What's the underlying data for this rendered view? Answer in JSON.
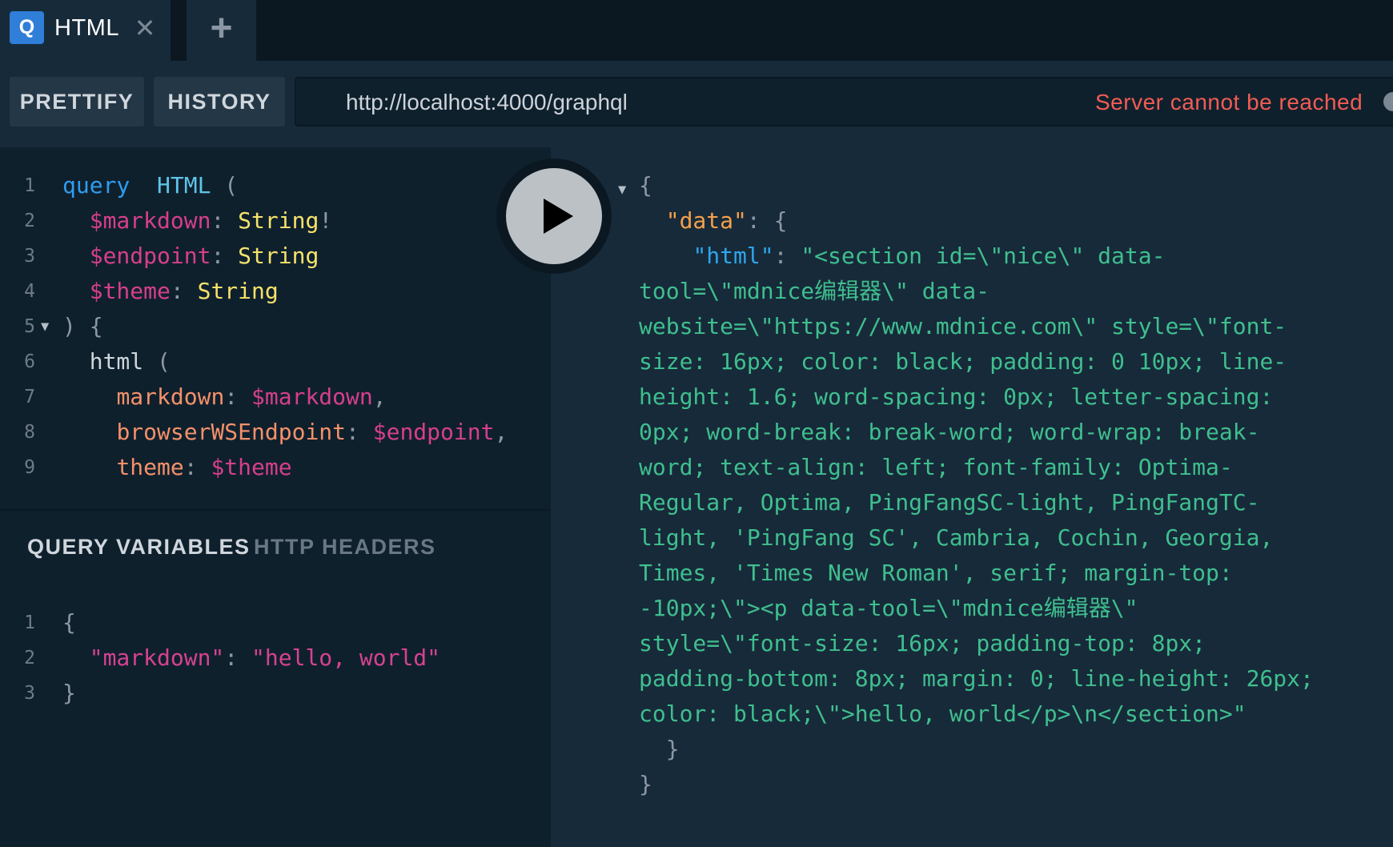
{
  "tab": {
    "logo_letter": "Q",
    "title": "HTML",
    "close_glyph": "✕",
    "add_glyph": "+"
  },
  "toolbar": {
    "prettify_label": "PRETTIFY",
    "history_label": "HISTORY",
    "endpoint_url": "http://localhost:4000/graphql",
    "server_status": "Server cannot be reached"
  },
  "query_editor": {
    "line_numbers": [
      "1",
      "2",
      "3",
      "4",
      "5",
      "6",
      "7",
      "8",
      "9"
    ],
    "lines": [
      [
        [
          "kw",
          "query"
        ],
        [
          "",
          "  "
        ],
        [
          "defname",
          "HTML"
        ],
        [
          "punct",
          " ("
        ]
      ],
      [
        [
          "",
          "  "
        ],
        [
          "var",
          "$markdown"
        ],
        [
          "punct",
          ": "
        ],
        [
          "type",
          "String"
        ],
        [
          "punct",
          "!"
        ]
      ],
      [
        [
          "",
          "  "
        ],
        [
          "var",
          "$endpoint"
        ],
        [
          "punct",
          ": "
        ],
        [
          "type",
          "String"
        ]
      ],
      [
        [
          "",
          "  "
        ],
        [
          "var",
          "$theme"
        ],
        [
          "punct",
          ": "
        ],
        [
          "type",
          "String"
        ]
      ],
      [
        [
          "punct",
          ") {"
        ]
      ],
      [
        [
          "",
          "  "
        ],
        [
          "field",
          "html"
        ],
        [
          "punct",
          " ("
        ]
      ],
      [
        [
          "",
          "    "
        ],
        [
          "arg",
          "markdown"
        ],
        [
          "punct",
          ": "
        ],
        [
          "var",
          "$markdown"
        ],
        [
          "punct",
          ","
        ]
      ],
      [
        [
          "",
          "    "
        ],
        [
          "arg",
          "browserWSEndpoint"
        ],
        [
          "punct",
          ": "
        ],
        [
          "var",
          "$endpoint"
        ],
        [
          "punct",
          ","
        ]
      ],
      [
        [
          "",
          "    "
        ],
        [
          "arg",
          "theme"
        ],
        [
          "punct",
          ": "
        ],
        [
          "var",
          "$theme"
        ]
      ]
    ]
  },
  "variables_panel": {
    "tab_variables": "QUERY VARIABLES",
    "tab_headers": "HTTP HEADERS",
    "line_numbers": [
      "1",
      "2",
      "3"
    ],
    "lines": [
      [
        [
          "punct",
          "{"
        ]
      ],
      [
        [
          "",
          "  "
        ],
        [
          "str",
          "\"markdown\""
        ],
        [
          "punct",
          ": "
        ],
        [
          "str",
          "\"hello, world\""
        ]
      ],
      [
        [
          "punct",
          "}"
        ]
      ]
    ]
  },
  "result": {
    "lines": [
      [
        [
          "punct",
          "{"
        ]
      ],
      [
        [
          "",
          "  "
        ],
        [
          "rkey-a",
          "\"data\""
        ],
        [
          "punct",
          ": {"
        ]
      ],
      [
        [
          "",
          "    "
        ],
        [
          "rkey-b",
          "\"html\""
        ],
        [
          "punct",
          ": "
        ],
        [
          "rstr",
          "\"<section id=\\\"nice\\\" data-"
        ]
      ],
      [
        [
          "rstr",
          "tool=\\\"mdnice编辑器\\\" data-"
        ]
      ],
      [
        [
          "rstr",
          "website=\\\"https://www.mdnice.com\\\" style=\\\"font-"
        ]
      ],
      [
        [
          "rstr",
          "size: 16px; color: black; padding: 0 10px; line-"
        ]
      ],
      [
        [
          "rstr",
          "height: 1.6; word-spacing: 0px; letter-spacing:"
        ]
      ],
      [
        [
          "rstr",
          "0px; word-break: break-word; word-wrap: break-"
        ]
      ],
      [
        [
          "rstr",
          "word; text-align: left; font-family: Optima-"
        ]
      ],
      [
        [
          "rstr",
          "Regular, Optima, PingFangSC-light, PingFangTC-"
        ]
      ],
      [
        [
          "rstr",
          "light, 'PingFang SC', Cambria, Cochin, Georgia,"
        ]
      ],
      [
        [
          "rstr",
          "Times, 'Times New Roman', serif; margin-top:"
        ]
      ],
      [
        [
          "rstr",
          "-10px;\\\"><p data-tool=\\\"mdnice编辑器\\\""
        ]
      ],
      [
        [
          "rstr",
          "style=\\\"font-size: 16px; padding-top: 8px;"
        ]
      ],
      [
        [
          "rstr",
          "padding-bottom: 8px; margin: 0; line-height: 26px;"
        ]
      ],
      [
        [
          "rstr",
          "color: black;\\\">hello, world</p>\\n</section>\""
        ]
      ],
      [
        [
          "",
          "  "
        ],
        [
          "punct",
          "}"
        ]
      ],
      [
        [
          "punct",
          "}"
        ]
      ]
    ]
  }
}
